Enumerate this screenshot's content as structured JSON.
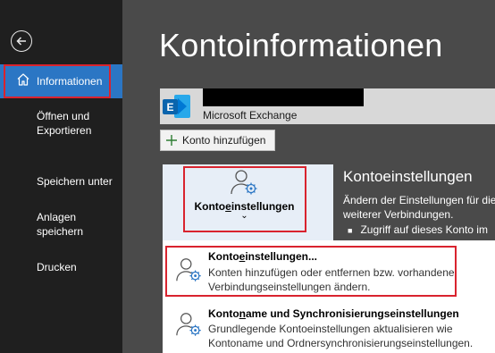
{
  "sidebar": {
    "back_icon": "back-arrow-icon",
    "items": [
      {
        "label": "Informationen",
        "icon": "home-icon",
        "active": true
      },
      {
        "label": "Öffnen und Exportieren"
      },
      {
        "label": "Speichern unter"
      },
      {
        "label": "Anlagen speichern"
      },
      {
        "label": "Drucken"
      }
    ]
  },
  "main": {
    "title": "Kontoinformationen",
    "account": {
      "type": "Microsoft Exchange",
      "icon": "exchange-icon"
    },
    "add_account_label": "Konto hinzufügen",
    "settings_tile": {
      "label_pre": "Konto",
      "label_key": "e",
      "label_post": "instellungen",
      "chevron": "⌄"
    },
    "section": {
      "title": "Kontoeinstellungen",
      "desc_line1": "Ändern der Einstellungen für die",
      "desc_line2": "weiterer Verbindungen.",
      "bullet": "Zugriff auf dieses Konto im"
    },
    "dropdown": [
      {
        "title_pre": "Konto",
        "title_key": "e",
        "title_post": "instellungen...",
        "desc": "Konten hinzufügen oder entfernen bzw. vorhandene Verbindungseinstellungen ändern.",
        "highlighted": true
      },
      {
        "title_pre": "Konto",
        "title_key": "n",
        "title_post": "ame und Synchronisierungseinstellungen",
        "desc": "Grundlegende Kontoeinstellungen aktualisieren wie Kontoname und Ordnersynchronisierungseinstellungen."
      }
    ]
  },
  "colors": {
    "sidebar_bg": "#1f1f1f",
    "active_bg": "#2b76c4",
    "main_bg": "#4a4a4a",
    "highlight": "#d9232e",
    "accent_icon": "#2b76c4"
  }
}
